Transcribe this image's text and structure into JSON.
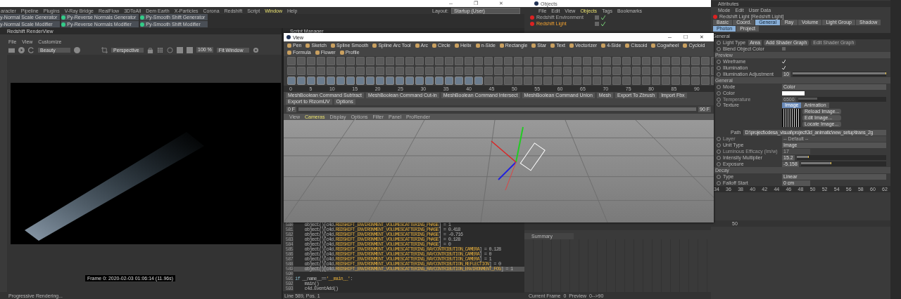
{
  "main_window": {
    "controls": [
      "─",
      "❐",
      "✕"
    ]
  },
  "menu_bar": {
    "items": [
      {
        "label": "aracter",
        "selected": false
      },
      {
        "label": "Pipeline",
        "selected": false
      },
      {
        "label": "Plugins",
        "selected": false
      },
      {
        "label": "V-Ray Bridge",
        "selected": false
      },
      {
        "label": "RealFlow",
        "selected": false
      },
      {
        "label": "3DToAll",
        "selected": false
      },
      {
        "label": "Dem Earth",
        "selected": false
      },
      {
        "label": "X-Particles",
        "selected": false
      },
      {
        "label": "Corona",
        "selected": false
      },
      {
        "label": "Redshift",
        "selected": false
      },
      {
        "label": "Script",
        "selected": false
      },
      {
        "label": "Window",
        "selected": true
      },
      {
        "label": "Help",
        "selected": false
      }
    ],
    "layout_label": "Layout:",
    "layout_value": "Startup (User)"
  },
  "plugin_buttons": [
    {
      "label": "y-Normal Scale Generator"
    },
    {
      "label": "Py-Reverse Normals Generator"
    },
    {
      "label": "Py-Smooth Shift Generator"
    },
    {
      "label": "y-Normal Scale Modifier"
    },
    {
      "label": "Py-Reverse Normals Modifier"
    },
    {
      "label": "Py-Smooth Shift Modifier"
    }
  ],
  "render_view": {
    "title": "Redshift RenderView",
    "menu": [
      "File",
      "View",
      "Customize"
    ],
    "aov": "Beauty",
    "camera": "Perspective",
    "zoom": "100 %",
    "fit": "Fit Window",
    "caption": "Frame 0:  2020-02-03 01:06:14  (11.96s)",
    "status": "Progressive Rendering..."
  },
  "script_manager": {
    "title": "Script Manager",
    "status": "Line 589, Pos. 1",
    "lines": [
      {
        "number": "580",
        "selected": false,
        "code": [
          {
            "kind": "plain",
            "text": "    object()[c4d."
          },
          {
            "kind": "constant",
            "text": "REDSHIFT_ENVIRONMENT_VOLUMESCATTERING_PHASE"
          },
          {
            "kind": "plain",
            "text": "] = 1"
          }
        ]
      },
      {
        "number": "581",
        "selected": false,
        "code": [
          {
            "kind": "plain",
            "text": "    object()[c4d."
          },
          {
            "kind": "constant",
            "text": "REDSHIFT_ENVIRONMENT_VOLUMESCATTERING_PHASE"
          },
          {
            "kind": "plain",
            "text": "] = 0.418"
          }
        ]
      },
      {
        "number": "582",
        "selected": false,
        "code": [
          {
            "kind": "plain",
            "text": "    object()[c4d."
          },
          {
            "kind": "constant",
            "text": "REDSHIFT_ENVIRONMENT_VOLUMESCATTERING_PHASE"
          },
          {
            "kind": "plain",
            "text": "] = -0.716"
          }
        ]
      },
      {
        "number": "583",
        "selected": false,
        "code": [
          {
            "kind": "plain",
            "text": "    object()[c4d."
          },
          {
            "kind": "constant",
            "text": "REDSHIFT_ENVIRONMENT_VOLUMESCATTERING_PHASE"
          },
          {
            "kind": "plain",
            "text": "] = 0.128"
          }
        ]
      },
      {
        "number": "584",
        "selected": false,
        "code": [
          {
            "kind": "plain",
            "text": "    object()[c4d."
          },
          {
            "kind": "constant",
            "text": "REDSHIFT_ENVIRONMENT_VOLUMESCATTERING_PHASE"
          },
          {
            "kind": "plain",
            "text": "] = 0"
          }
        ]
      },
      {
        "number": "585",
        "selected": false,
        "code": [
          {
            "kind": "plain",
            "text": "    object()[c4d."
          },
          {
            "kind": "constant",
            "text": "REDSHIFT_ENVIRONMENT_VOLUMESCATTERING_RAYCONTRIBUTION_CAMERA"
          },
          {
            "kind": "plain",
            "text": "] = 0.128"
          }
        ]
      },
      {
        "number": "586",
        "selected": false,
        "code": [
          {
            "kind": "plain",
            "text": "    object()[c4d."
          },
          {
            "kind": "constant",
            "text": "REDSHIFT_ENVIRONMENT_VOLUMESCATTERING_RAYCONTRIBUTION_CAMERA"
          },
          {
            "kind": "plain",
            "text": "] = 0"
          }
        ]
      },
      {
        "number": "587",
        "selected": false,
        "code": [
          {
            "kind": "plain",
            "text": "    object()[c4d."
          },
          {
            "kind": "constant",
            "text": "REDSHIFT_ENVIRONMENT_VOLUMESCATTERING_RAYCONTRIBUTION_CAMERA"
          },
          {
            "kind": "plain",
            "text": "] = 1"
          }
        ]
      },
      {
        "number": "588",
        "selected": false,
        "code": [
          {
            "kind": "plain",
            "text": "    object()[c4d."
          },
          {
            "kind": "constant",
            "text": "REDSHIFT_ENVIRONMENT_VOLUMESCATTERING_RAYCONTRIBUTION_REFLECTION"
          },
          {
            "kind": "plain",
            "text": "] = 0"
          }
        ]
      },
      {
        "number": "589",
        "selected": true,
        "code": [
          {
            "kind": "plain",
            "text": "    object()[c4d."
          },
          {
            "kind": "constant",
            "text": "REDSHIFT_ENVIRONMENT_VOLUMESCATTERING_RAYCONTRIBUTION_ENVIRONMENT_FOG"
          },
          {
            "kind": "plain",
            "text": "] = 1"
          }
        ]
      },
      {
        "number": "590",
        "selected": false
      },
      {
        "number": "591",
        "selected": false,
        "code": [
          {
            "kind": "keyword",
            "text": "if "
          },
          {
            "kind": "plain",
            "text": "__name__=="
          },
          {
            "kind": "string",
            "text": "'__main__'"
          },
          {
            "kind": "plain",
            "text": ":"
          }
        ]
      },
      {
        "number": "592",
        "selected": false,
        "code": [
          {
            "kind": "plain",
            "text": "    main()"
          }
        ]
      },
      {
        "number": "593",
        "selected": false,
        "code": [
          {
            "kind": "plain",
            "text": "    c4d.EventAdd()"
          }
        ]
      }
    ]
  },
  "view_window": {
    "title": "View",
    "controls": [
      "─",
      "☐",
      "✕"
    ],
    "tools": [
      "Pen",
      "Sketch",
      "Spline Smooth",
      "Spline Arc Tool",
      "Arc",
      "Circle",
      "Helix",
      "n-Side",
      "Rectangle",
      "Star",
      "Text",
      "Vectorizer",
      "4-Side",
      "Cissoid",
      "Cogwheel",
      "Cycloid",
      "Formula",
      "Flower",
      "Profile"
    ],
    "ruler_ticks": [
      "0",
      "5",
      "10",
      "15",
      "20",
      "25",
      "30",
      "35",
      "40",
      "45",
      "50",
      "55",
      "60",
      "65",
      "70",
      "75",
      "80",
      "85",
      "90"
    ],
    "commands": [
      "MeshBoolean Command Subtract",
      "MeshBoolean Command Cut-in",
      "MeshBoolean Command Intersect",
      "MeshBoolean Command Union",
      "Mesh",
      "Export To Zbrush",
      "Import Fbx",
      "Export to RizomUV",
      "Options"
    ],
    "start_frame": "0 F",
    "end_frame": "90 F",
    "viewport_menu": [
      {
        "label": "View",
        "selected": false
      },
      {
        "label": "Cameras",
        "selected": true
      },
      {
        "label": "Display",
        "selected": false
      },
      {
        "label": "Options",
        "selected": false
      },
      {
        "label": "Filter",
        "selected": false
      },
      {
        "label": "Panel",
        "selected": false
      },
      {
        "label": "ProRender",
        "selected": false
      }
    ]
  },
  "objects": {
    "title": "Objects",
    "menu": [
      {
        "label": "File",
        "selected": false
      },
      {
        "label": "Edit",
        "selected": false
      },
      {
        "label": "View",
        "selected": false
      },
      {
        "label": "Objects",
        "selected": true
      },
      {
        "label": "Tags",
        "selected": false
      },
      {
        "label": "Bookmarks",
        "selected": false
      }
    ],
    "items": [
      {
        "name": "Redshift Environment",
        "selected": false,
        "enabled": true
      },
      {
        "name": "Redshift Light",
        "selected": true,
        "enabled": true
      }
    ]
  },
  "timeline": {
    "track": "Summary",
    "ticks": [
      "50"
    ],
    "status": "Current Frame  0  Preview  0-->90"
  },
  "attributes": {
    "title": "Attributes",
    "menu": [
      "Mode",
      "Edit",
      "User Data"
    ],
    "object": "Redshift Light [Redshift Light]",
    "tabs": [
      {
        "label": "Basic",
        "selected": false
      },
      {
        "label": "Coord.",
        "selected": false
      },
      {
        "label": "General",
        "selected": true
      },
      {
        "label": "Ray",
        "selected": false
      },
      {
        "label": "Volume",
        "selected": false
      },
      {
        "label": "Light Group",
        "selected": false
      },
      {
        "label": "Shadow",
        "selected": false
      },
      {
        "label": "Photon",
        "selected": true
      },
      {
        "label": "Project",
        "selected": false
      }
    ],
    "section": "General",
    "rows": [
      {
        "kind": "light-type",
        "label": "Light Type",
        "value": "Area",
        "buttons": [
          {
            "label": "Add Shader Graph",
            "disabled": false
          },
          {
            "label": "Edit Shader Graph",
            "disabled": true
          }
        ]
      },
      {
        "kind": "checkbox",
        "label": "Blend Object Color",
        "checked": false
      },
      {
        "kind": "group",
        "label": "Preview"
      },
      {
        "kind": "checkbox",
        "label": "Wireframe",
        "checked": true
      },
      {
        "kind": "checkbox",
        "label": "Illumination",
        "checked": true
      },
      {
        "kind": "slider",
        "label": "Illumination Adjustment",
        "value": "10",
        "level": 1,
        "disabled": false
      },
      {
        "kind": "group",
        "label": "General"
      },
      {
        "kind": "dropdown",
        "label": "Mode",
        "value": "Color",
        "disabled": false
      },
      {
        "kind": "color",
        "label": "Color"
      },
      {
        "kind": "slider",
        "label": "Temperature",
        "value": "6500",
        "level": 0.22,
        "disabled": true
      },
      {
        "kind": "texture",
        "label": "Texture",
        "tabs": [
          {
            "label": "Image",
            "selected": true
          },
          {
            "label": "Animation",
            "selected": false
          }
        ],
        "buttons": [
          "Reload Image...",
          "Edit Image...",
          "Locate Image..."
        ]
      },
      {
        "kind": "path",
        "label": "Path",
        "value": "D:\\project\\odesa_visual\\project\\3d_animatic\\new_setup\\trans_2g"
      },
      {
        "kind": "dropdown",
        "label": "Layer",
        "value": "-- Default --",
        "disabled": true
      },
      {
        "kind": "dropdown",
        "label": "Unit Type",
        "value": "Image",
        "disabled": false
      },
      {
        "kind": "number",
        "label": "Luminous Efficacy (lm/w)",
        "value": "17",
        "disabled": true
      },
      {
        "kind": "slider",
        "label": "Intensity Multiplier",
        "value": "15.2",
        "level": 0.13,
        "disabled": false
      },
      {
        "kind": "slider",
        "label": "Exposure",
        "value": "-5.158",
        "level": 0.35,
        "disabled": false
      },
      {
        "kind": "group",
        "label": "Decay"
      },
      {
        "kind": "dropdown",
        "label": "Type",
        "value": "Linear",
        "disabled": false
      },
      {
        "kind": "number",
        "label": "Falloff Start",
        "value": "0 cm",
        "disabled": false
      }
    ],
    "ruler_ticks": [
      "34",
      "36",
      "38",
      "40",
      "42",
      "44",
      "46",
      "48",
      "50",
      "52",
      "54",
      "56",
      "58",
      "60",
      "62"
    ]
  }
}
